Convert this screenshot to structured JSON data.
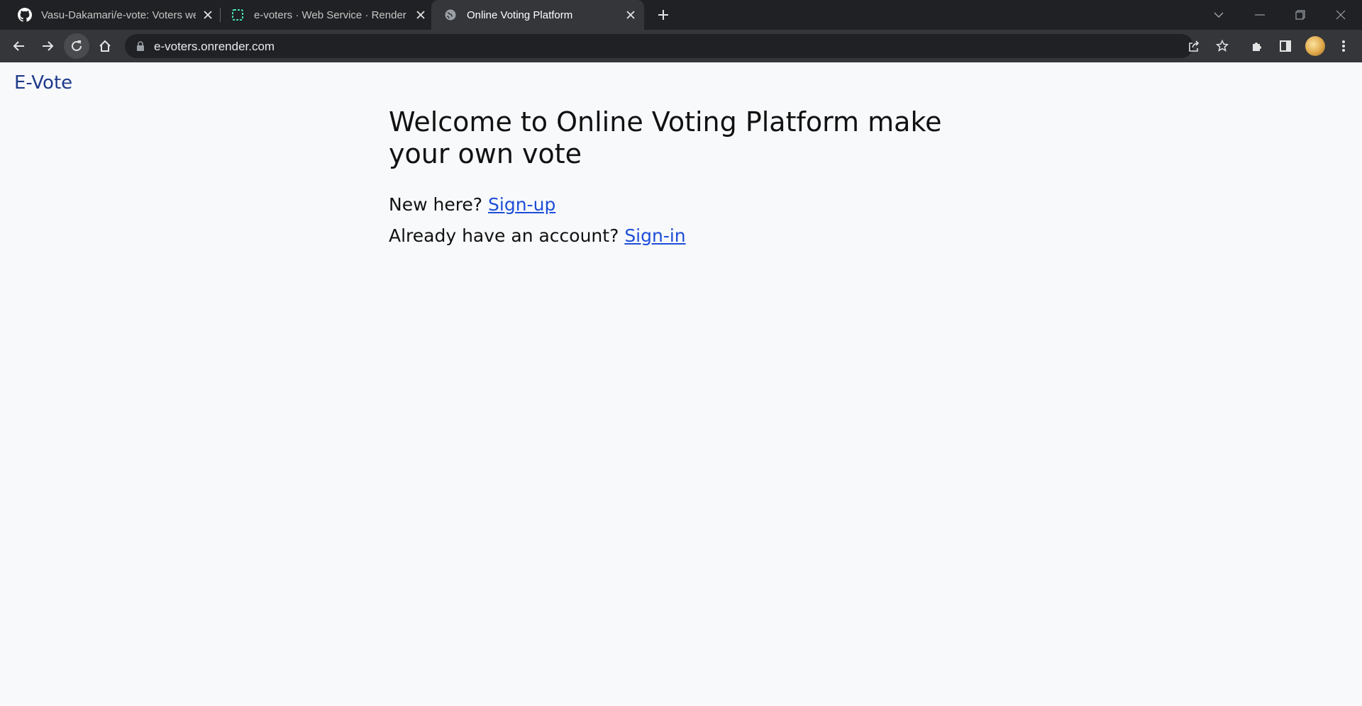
{
  "browser": {
    "tabs": [
      {
        "title": "Vasu-Dakamari/e-vote: Voters web",
        "icon": "github-icon",
        "active": false
      },
      {
        "title": "e-voters · Web Service · Render",
        "icon": "render-icon",
        "active": false
      },
      {
        "title": "Online Voting Platform",
        "icon": "globe-icon",
        "active": true
      }
    ],
    "url": "e-voters.onrender.com",
    "colors": {
      "tabstrip": "#202124",
      "toolbar": "#35363a",
      "omnibox": "#202124"
    }
  },
  "page": {
    "brand": "E-Vote",
    "headline": "Welcome to Online Voting Platform make your own vote",
    "signup_prompt": "New here?",
    "signup_link": "Sign-up",
    "signin_prompt": "Already have an account?",
    "signin_link": "Sign-in",
    "colors": {
      "brand": "#1e3a8a",
      "link": "#1d4ed8",
      "background": "#f8f9fb"
    }
  }
}
